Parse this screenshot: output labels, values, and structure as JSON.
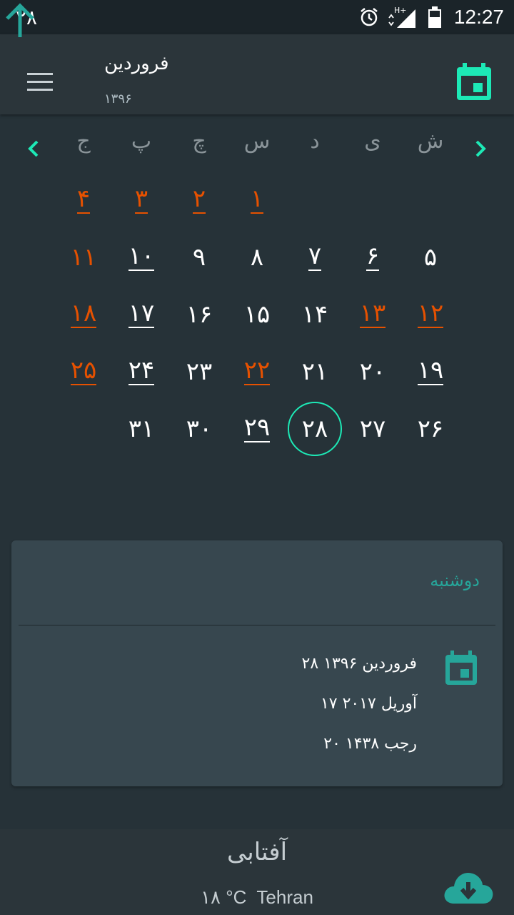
{
  "status_bar": {
    "left_number": "۲۸",
    "time": "12:27",
    "network": "H+"
  },
  "header": {
    "month": "فروردین",
    "year": "۱۳۹۶"
  },
  "weekdays": [
    "ش",
    "ی",
    "د",
    "س",
    "چ",
    "پ",
    "ج"
  ],
  "days": [
    {
      "label": "۱",
      "holiday": true,
      "event": true
    },
    {
      "label": "۲",
      "holiday": true,
      "event": true
    },
    {
      "label": "۳",
      "holiday": true,
      "event": true
    },
    {
      "label": "۴",
      "holiday": true,
      "event": true
    },
    {
      "label": "۵",
      "holiday": false,
      "event": false
    },
    {
      "label": "۶",
      "holiday": false,
      "event": true
    },
    {
      "label": "۷",
      "holiday": false,
      "event": true
    },
    {
      "label": "۸",
      "holiday": false,
      "event": false
    },
    {
      "label": "۹",
      "holiday": false,
      "event": false
    },
    {
      "label": "۱۰",
      "holiday": false,
      "event": true
    },
    {
      "label": "۱۱",
      "holiday": true,
      "event": false
    },
    {
      "label": "۱۲",
      "holiday": true,
      "event": true
    },
    {
      "label": "۱۳",
      "holiday": true,
      "event": true
    },
    {
      "label": "۱۴",
      "holiday": false,
      "event": false
    },
    {
      "label": "۱۵",
      "holiday": false,
      "event": false
    },
    {
      "label": "۱۶",
      "holiday": false,
      "event": false
    },
    {
      "label": "۱۷",
      "holiday": false,
      "event": true
    },
    {
      "label": "۱۸",
      "holiday": true,
      "event": true
    },
    {
      "label": "۱۹",
      "holiday": false,
      "event": true
    },
    {
      "label": "۲۰",
      "holiday": false,
      "event": false
    },
    {
      "label": "۲۱",
      "holiday": false,
      "event": false
    },
    {
      "label": "۲۲",
      "holiday": true,
      "event": true
    },
    {
      "label": "۲۳",
      "holiday": false,
      "event": false
    },
    {
      "label": "۲۴",
      "holiday": false,
      "event": true
    },
    {
      "label": "۲۵",
      "holiday": true,
      "event": true
    },
    {
      "label": "۲۶",
      "holiday": false,
      "event": false
    },
    {
      "label": "۲۷",
      "holiday": false,
      "event": false
    },
    {
      "label": "۲۸",
      "holiday": false,
      "event": false,
      "selected": true
    },
    {
      "label": "۲۹",
      "holiday": false,
      "event": true
    },
    {
      "label": "۳۰",
      "holiday": false,
      "event": false
    },
    {
      "label": "۳۱",
      "holiday": false,
      "event": false
    }
  ],
  "first_weekday_index": 3,
  "card": {
    "weekday": "دوشنبه",
    "persian_date": "۲۸ فروردین ۱۳۹۶",
    "gregorian_date": "۱۷ آوریل ۲۰۱۷",
    "hijri_date": "۲۰ رجب ۱۴۳۸"
  },
  "footer": {
    "condition": "آفتابی",
    "temperature": "۱۸ °C",
    "city": "Tehran"
  },
  "colors": {
    "accent": "#1de9b6",
    "teal": "#26a69a",
    "holiday": "#e65100",
    "background": "#263238",
    "card": "#37474f"
  },
  "icons": {
    "menu": "menu-icon",
    "today": "calendar-today-icon",
    "prev": "chevron-left-icon",
    "next": "chevron-right-icon",
    "up": "arrow-up-icon",
    "cloud": "cloud-download-icon"
  }
}
